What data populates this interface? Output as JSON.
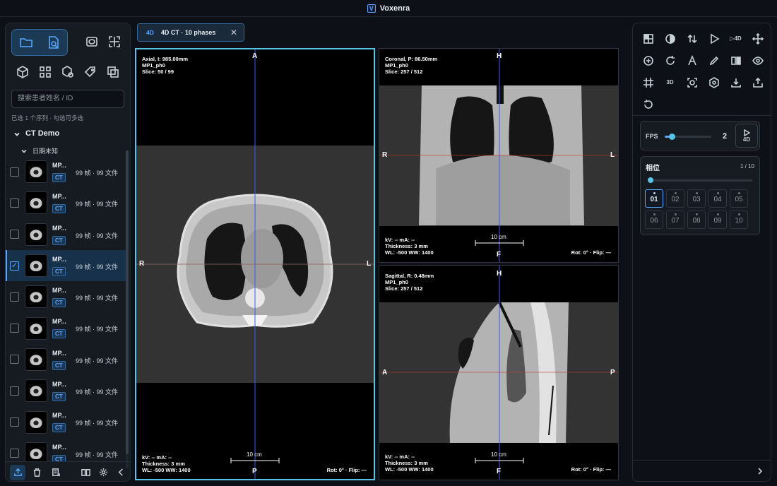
{
  "app": {
    "title": "Voxenra",
    "logo": "V"
  },
  "sidebar": {
    "search_placeholder": "搜索患者姓名 / ID",
    "selection_hint": "已选 1 个序列 · 勾选可多选",
    "patient": "CT Demo",
    "study": "日期未知",
    "series": [
      {
        "name": "MP...",
        "modality": "CT",
        "meta": "99 帧 · 99 文件",
        "checked": false
      },
      {
        "name": "MP...",
        "modality": "CT",
        "meta": "99 帧 · 99 文件",
        "checked": false
      },
      {
        "name": "MP...",
        "modality": "CT",
        "meta": "99 帧 · 99 文件",
        "checked": false
      },
      {
        "name": "MP...",
        "modality": "CT",
        "meta": "99 帧 · 99 文件",
        "checked": true
      },
      {
        "name": "MP...",
        "modality": "CT",
        "meta": "99 帧 · 99 文件",
        "checked": false
      },
      {
        "name": "MP...",
        "modality": "CT",
        "meta": "99 帧 · 99 文件",
        "checked": false
      },
      {
        "name": "MP...",
        "modality": "CT",
        "meta": "99 帧 · 99 文件",
        "checked": false
      },
      {
        "name": "MP...",
        "modality": "CT",
        "meta": "99 帧 · 99 文件",
        "checked": false
      },
      {
        "name": "MP...",
        "modality": "CT",
        "meta": "99 帧 · 99 文件",
        "checked": false
      },
      {
        "name": "MP...",
        "modality": "CT",
        "meta": "99 帧 · 99 文件",
        "checked": false
      }
    ]
  },
  "tab": {
    "badge": "4D",
    "label": "4D CT · 10 phases"
  },
  "viewports": {
    "axial": {
      "info": [
        "Axial, I: 985.00mm",
        "MP1_ph0",
        "Slice: 50 / 99"
      ],
      "top": "A",
      "bottom": "P",
      "left": "R",
      "right": "L",
      "bottom_left": [
        "kV: --    mA: --",
        "Thickness: 3 mm",
        "WL: -500   WW: 1400"
      ],
      "bottom_right": "Rot: 0° · Flip: —",
      "scale": "10 cm"
    },
    "coronal": {
      "info": [
        "Coronal, P: 86.50mm",
        "MP1_ph0",
        "Slice: 257 / 512"
      ],
      "top": "H",
      "bottom": "F",
      "left": "R",
      "right": "L",
      "bottom_left": [
        "kV: --    mA: --",
        "Thickness: 3 mm",
        "WL: -500   WW: 1400"
      ],
      "bottom_right": "Rot: 0° · Flip: —",
      "scale": "10 cm"
    },
    "sagittal": {
      "info": [
        "Sagittal, R: 0.48mm",
        "MP1_ph0",
        "Slice: 257 / 512"
      ],
      "top": "H",
      "bottom": "F",
      "left": "A",
      "right": "P",
      "bottom_left": [
        "kV: --    mA: --",
        "Thickness: 3 mm",
        "WL: -500   WW: 1400"
      ],
      "bottom_right": "Rot: 0° · Flip: —",
      "scale": "10 cm"
    }
  },
  "playback": {
    "fps_label": "FPS",
    "fps_value": "2",
    "fps_fraction": 0.12,
    "play_label": "4D",
    "phase_title": "相位",
    "phase_count": "1 / 10",
    "phase_fraction": 0.0,
    "phases": [
      "01",
      "02",
      "03",
      "04",
      "05",
      "06",
      "07",
      "08",
      "09",
      "10"
    ],
    "active_phase": "01"
  },
  "colors": {
    "accent": "#58a6ff",
    "active_border": "#58c4e8",
    "crosshair_v": "#3b5bdb",
    "crosshair_h": "#c0392b"
  }
}
